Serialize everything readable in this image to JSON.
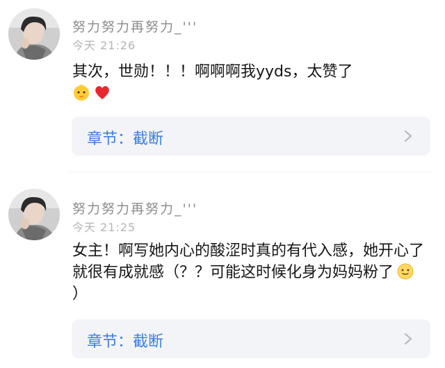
{
  "comments": [
    {
      "username": "努力努力再努力_'''",
      "time": "今天 21:26",
      "text": "其次，世勋！！！啊啊啊我yyds，太赞了",
      "emojis": [
        "chick-emoji",
        "red-heart-emoji"
      ],
      "chapter_label": "章节：截断"
    },
    {
      "username": "努力努力再努力_'''",
      "time": "今天 21:25",
      "text": "女主！啊写她内心的酸涩时真的有代入感，她开心了就很有成就感（？？可能这时候化身为妈妈粉了",
      "text_end": "）",
      "emojis": [
        "smiling-face-emoji"
      ],
      "chapter_label": "章节：截断"
    }
  ],
  "colors": {
    "username": "#8d8d8d",
    "time": "#b4b4b4",
    "chapter_text": "#3d7de3",
    "chapter_bg": "#f3f4f8"
  }
}
